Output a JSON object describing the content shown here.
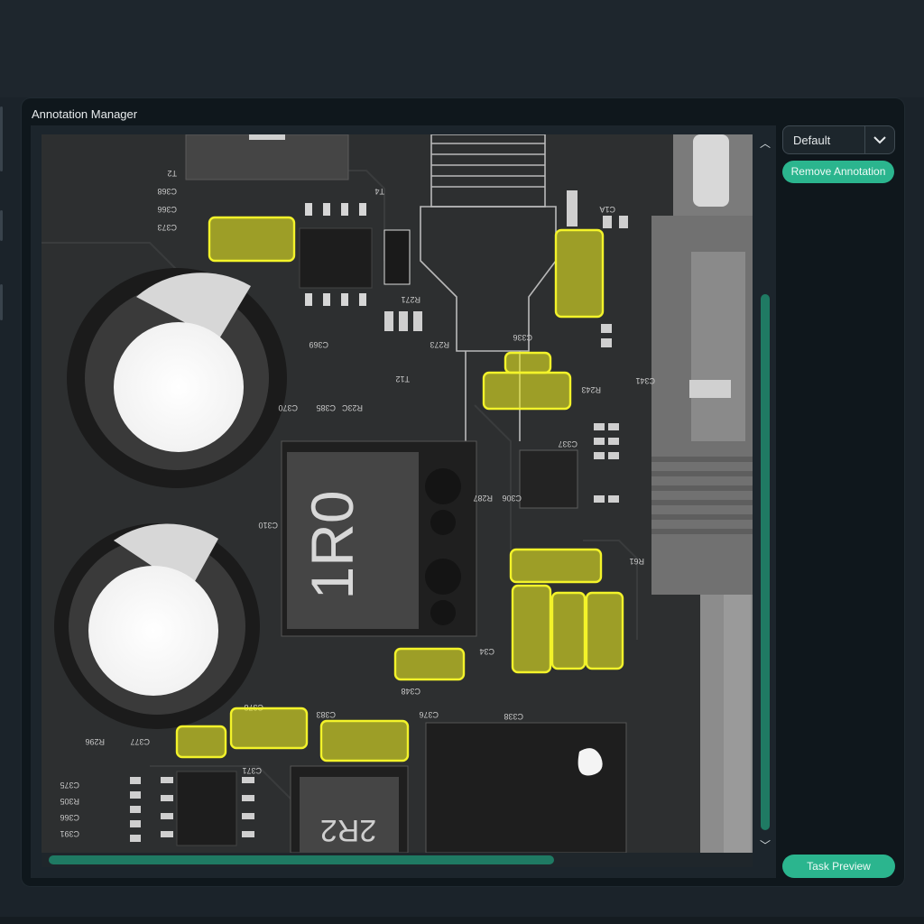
{
  "window": {
    "title": "Annotation Manager"
  },
  "dropdown": {
    "selected": "Default",
    "icon": "chevron-down-icon"
  },
  "buttons": {
    "remove_annotation": "Remove Annotation",
    "task_preview": "Task Preview"
  },
  "colors": {
    "accent": "#2bb58e",
    "scroll_thumb": "#1f7a63",
    "annotation": "#f0f020"
  },
  "image": {
    "silkscreen": {
      "inductor_main": "1R0",
      "inductor_small": "2R2",
      "labels": [
        "T2",
        "C368",
        "C366",
        "C373",
        "T4",
        "R271",
        "C369",
        "R273",
        "C336",
        "R243",
        "C1A",
        "C341",
        "C385",
        "R23C",
        "C370",
        "C337",
        "R287",
        "C306",
        "R61",
        "C310",
        "C34",
        "C348",
        "C376",
        "C378",
        "C383",
        "C371",
        "C377",
        "R296",
        "C375",
        "R305",
        "C366",
        "C391",
        "C338",
        "T12"
      ]
    },
    "annotations_count": 12
  }
}
